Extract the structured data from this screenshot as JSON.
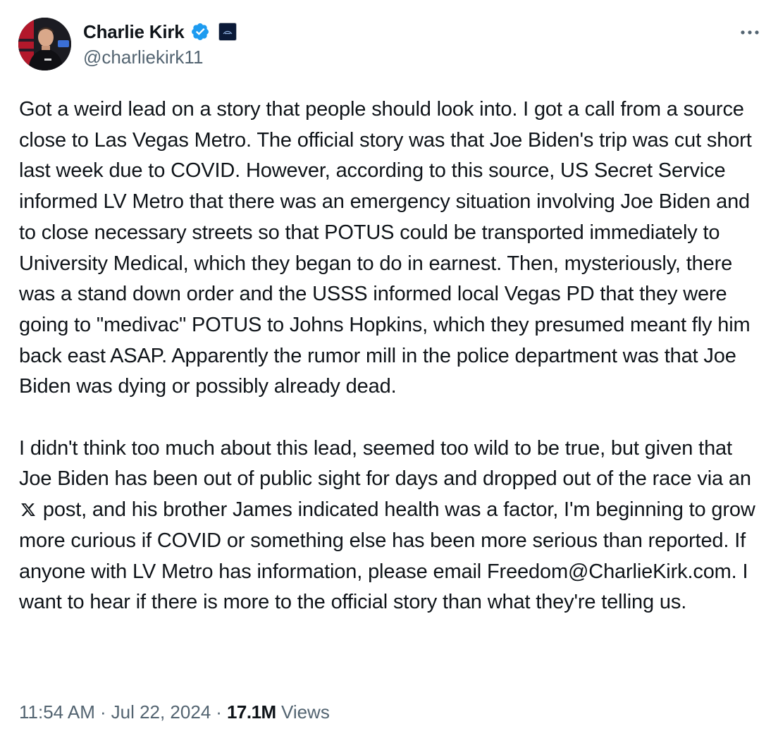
{
  "author": {
    "display_name": "Charlie Kirk",
    "handle": "@charliekirk11",
    "verified_color": "#1d9bf0",
    "avatar_icon": "profile-photo",
    "affiliation_icon": "organization-badge"
  },
  "tweet": {
    "paragraphs": [
      {
        "text": "Got a weird lead on a story that people should look into. I got a call from a source close to Las Vegas Metro. The official story was that Joe Biden's trip was cut short last week due to COVID. However, according to this source, US Secret Service informed LV Metro that there was an emergency situation involving Joe Biden and to close necessary streets so that POTUS could be transported immediately to University Medical, which they began to do in earnest. Then, mysteriously, there was a stand down order and the USSS informed local Vegas PD that they were going to \"medivac\" POTUS to Johns Hopkins, which they presumed meant fly him back east ASAP. Apparently the rumor mill in the police department was that Joe Biden was dying or possibly already dead."
      },
      {
        "text_before_icon": "I didn't think too much about this lead, seemed too wild to be true, but given that Joe Biden has been out of public sight for days and dropped out of the race via an",
        "inline_icon": "x-logo-icon",
        "text_after_icon": "post, and his brother James indicated health was a factor, I'm beginning to grow more curious if COVID or something else has been more serious than reported. If anyone with LV Metro has information, please email Freedom@CharlieKirk.com. I want to hear if there is more to the official story than what they're telling us."
      }
    ],
    "time": "11:54 AM",
    "separator": "·",
    "date": "Jul 22, 2024",
    "views_count": "17.1M",
    "views_label": "Views"
  },
  "colors": {
    "text_primary": "#0f1419",
    "text_secondary": "#536471",
    "accent": "#1d9bf0"
  }
}
